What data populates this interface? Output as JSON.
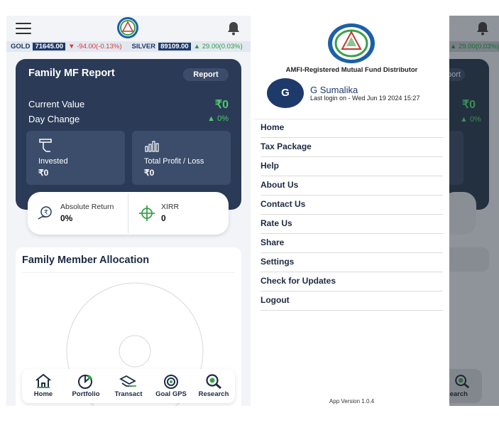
{
  "ticker": {
    "gold_label": "GOLD",
    "gold_value": "71645.00",
    "gold_change": "▼ -94.00(-0.13%)",
    "silver_label": "SILVER",
    "silver_value": "89109.00",
    "silver_change": "▲ 29.00(0.03%)",
    "right_partial": "▲ 29.00(0.03%)"
  },
  "report": {
    "title": "Family MF Report",
    "button": "Report",
    "current_value_label": "Current Value",
    "current_value": "₹0",
    "day_change_label": "Day Change",
    "day_change": "▲ 0%",
    "invested_label": "Invested",
    "invested_value": "₹0",
    "profit_label": "Total Profit / Loss",
    "profit_value": "₹0"
  },
  "returns": {
    "absolute_label": "Absolute Return",
    "absolute_value": "0%",
    "xirr_label": "XIRR",
    "xirr_value": "0"
  },
  "allocation": {
    "title": "Family Member Allocation"
  },
  "nav": [
    {
      "label": "Home",
      "icon": "home-icon"
    },
    {
      "label": "Portfolio",
      "icon": "pie-chart-icon"
    },
    {
      "label": "Transact",
      "icon": "transact-icon"
    },
    {
      "label": "Goal GPS",
      "icon": "target-icon"
    },
    {
      "label": "Research",
      "icon": "magnifier-icon"
    }
  ],
  "drawer": {
    "distributor": "AMFI-Registered Mutual Fund Distributor",
    "avatar_letter": "G",
    "user_name": "G Sumalika",
    "last_login": "Last login on - Wed Jun 19 2024 15:27",
    "menu": [
      {
        "label": "Home"
      },
      {
        "label": "Tax Package"
      },
      {
        "label": "Help"
      },
      {
        "label": "About Us"
      },
      {
        "label": "Contact Us"
      },
      {
        "label": "Rate Us"
      },
      {
        "label": "Share"
      },
      {
        "label": "Settings"
      },
      {
        "label": "Check for Updates"
      },
      {
        "label": "Logout"
      }
    ],
    "version": "App Version 1.0.4"
  },
  "right_peek": {
    "report": "port",
    "value": "₹0",
    "change": "▲ 0%",
    "loss": "oss",
    "research": "esearch"
  },
  "colors": {
    "navy": "#2b3b57",
    "accent_green": "#4ec96b",
    "brand_blue": "#1d3a6b"
  }
}
